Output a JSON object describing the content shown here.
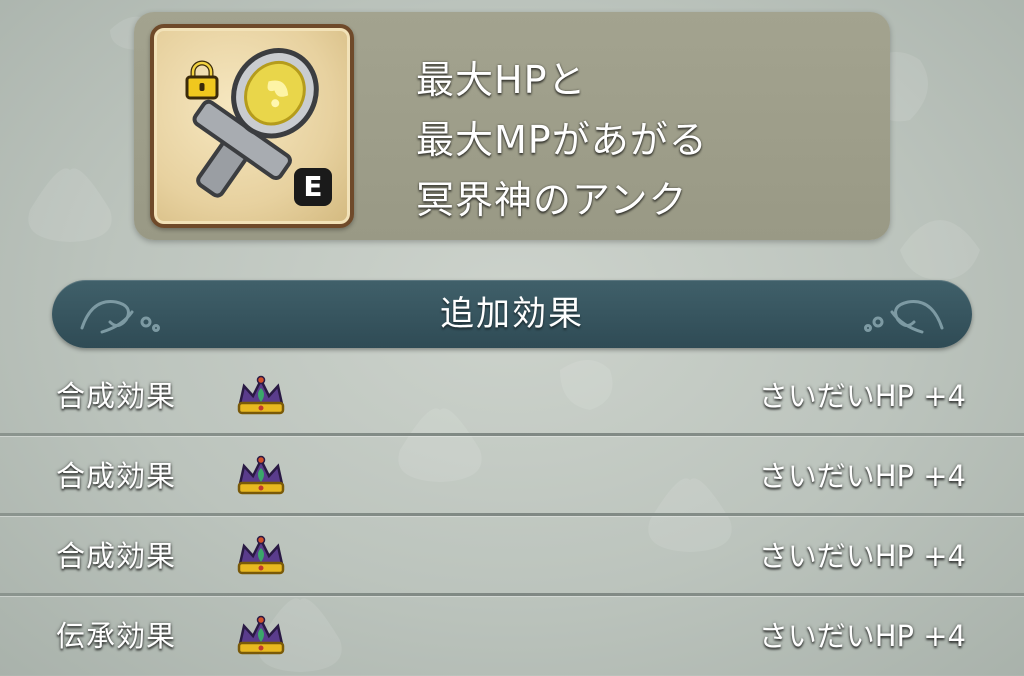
{
  "item": {
    "icon": "ankh-accessory-icon",
    "lock_icon": "padlock-icon",
    "equipped_badge": "E",
    "description_lines": [
      "最大HPと",
      "最大MPがあがる",
      "冥界神のアンク"
    ]
  },
  "section": {
    "title": "追加効果"
  },
  "effects": [
    {
      "label": "合成効果",
      "icon": "crown-icon",
      "value": "さいだいHP  +4"
    },
    {
      "label": "合成効果",
      "icon": "crown-icon",
      "value": "さいだいHP  +4"
    },
    {
      "label": "合成効果",
      "icon": "crown-icon",
      "value": "さいだいHP  +4"
    },
    {
      "label": "伝承効果",
      "icon": "crown-icon",
      "value": "さいだいHP  +4"
    }
  ],
  "colors": {
    "header_bg": "#2f4b55",
    "panel_bg": "#9e9e8a",
    "frame_border": "#6f4a2a",
    "crown_gold": "#e8b820",
    "crown_purple": "#5a3c8c"
  }
}
